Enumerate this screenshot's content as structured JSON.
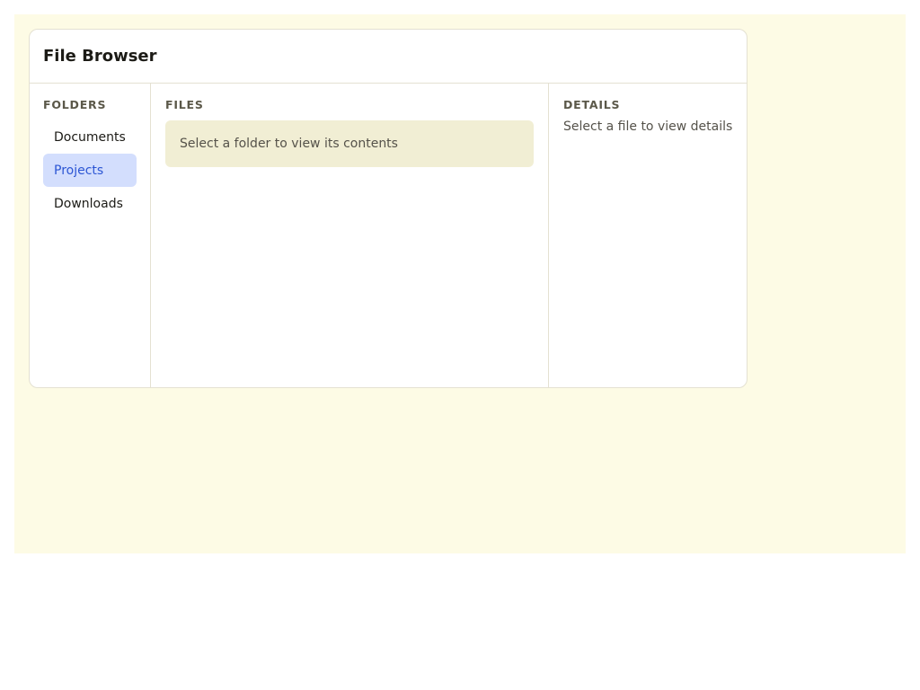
{
  "window": {
    "title": "File Browser"
  },
  "folders": {
    "heading": "FOLDERS",
    "items": [
      {
        "label": "Documents",
        "selected": false
      },
      {
        "label": "Projects",
        "selected": true
      },
      {
        "label": "Downloads",
        "selected": false
      }
    ]
  },
  "files": {
    "heading": "FILES",
    "empty_message": "Select a folder to view its contents"
  },
  "details": {
    "heading": "DETAILS",
    "empty_message": "Select a file to view details"
  },
  "colors": {
    "page_background": "#fdfbe5",
    "accent": "#2c56d4",
    "selected_background": "#d3defd",
    "empty_state_background": "#f1eed4"
  }
}
